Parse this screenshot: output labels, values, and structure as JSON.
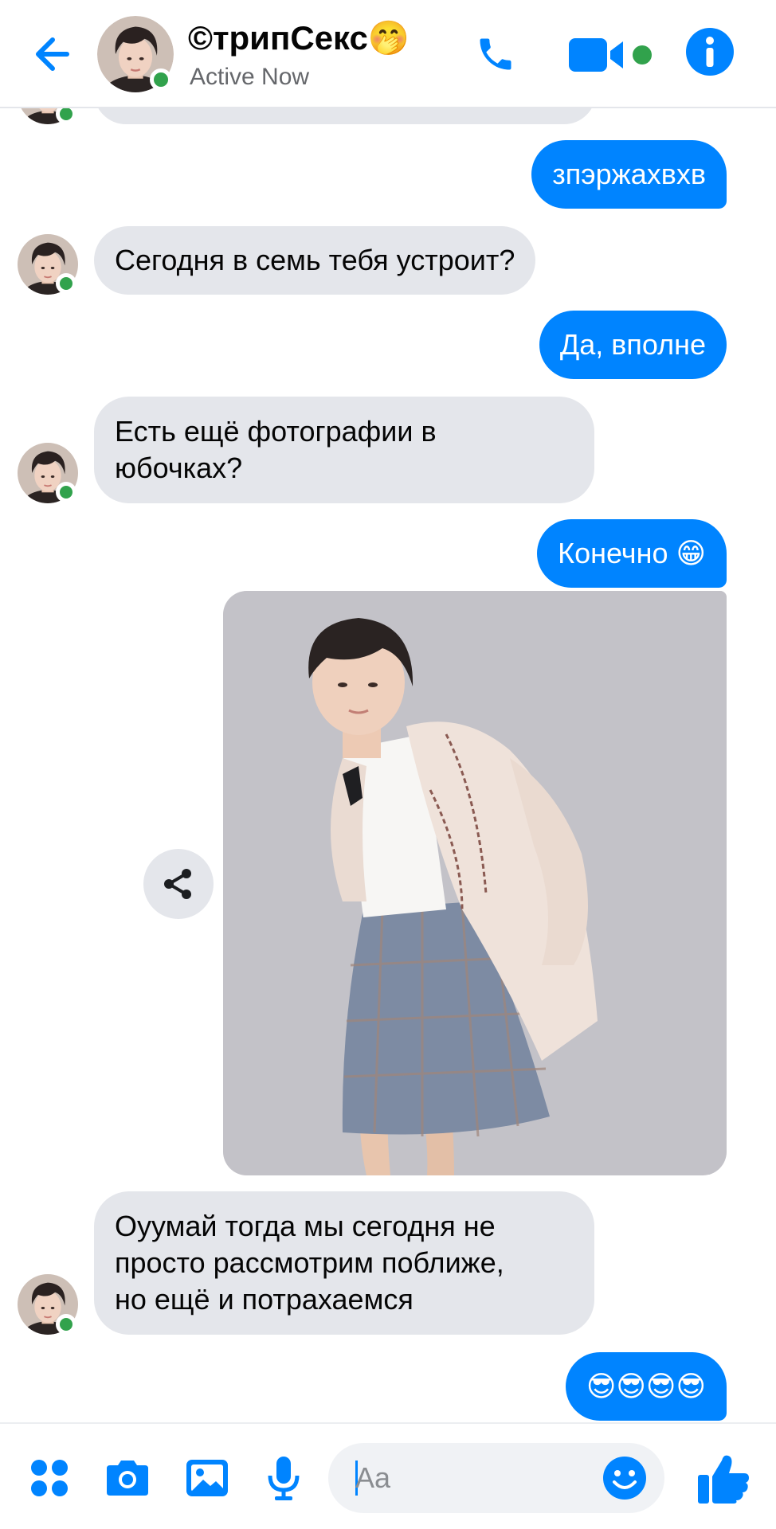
{
  "header": {
    "contact_name": "©трипСекс🤭",
    "status": "Active Now"
  },
  "messages": [
    {
      "from": "me",
      "text": "зпэржахвхв"
    },
    {
      "from": "them",
      "text": "Сегодня в семь тебя устроит?"
    },
    {
      "from": "me",
      "text": "Да, вполне"
    },
    {
      "from": "them",
      "lines": [
        "Есть ещё фотографии в",
        "юбочках?"
      ]
    },
    {
      "from": "me",
      "text": "Конечно 😁"
    },
    {
      "from": "me",
      "type": "photo"
    },
    {
      "from": "them",
      "lines": [
        "Оуумай тогда мы сегодня не",
        "просто рассмотрим поближе,",
        "но ещё и потрахаемся"
      ]
    },
    {
      "from": "me",
      "text": "😎😎😎😎"
    }
  ],
  "composer": {
    "placeholder": "Aa"
  },
  "colors": {
    "accent": "#0084ff",
    "incoming_bubble": "#e4e6eb",
    "online": "#31a24c",
    "subtitle": "#65676b"
  },
  "icons": {
    "back": "arrow-left-icon",
    "call": "phone-icon",
    "video": "video-camera-icon",
    "info": "info-icon",
    "share": "share-icon",
    "menu": "four-dots-icon",
    "camera": "camera-icon",
    "gallery": "image-icon",
    "voice": "microphone-icon",
    "emoji": "smiley-icon",
    "like": "thumbs-up-icon"
  }
}
